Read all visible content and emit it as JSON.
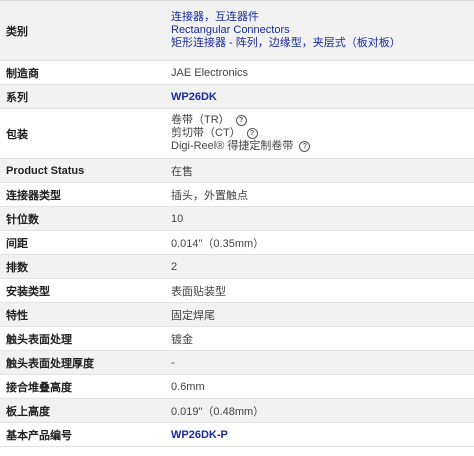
{
  "rows": [
    {
      "label": "类别",
      "values": [
        "连接器，互连器件",
        "Rectangular Connectors",
        "矩形连接器 - 阵列，边缘型，夹层式（板对板）"
      ]
    },
    {
      "label": "制造商",
      "value": "JAE Electronics"
    },
    {
      "label": "系列",
      "value": "WP26DK"
    },
    {
      "label": "包装",
      "packaging": [
        "卷带（TR）",
        "剪切带（CT）",
        "Digi-Reel® 得捷定制卷带"
      ]
    },
    {
      "label": "Product Status",
      "value": "在售"
    },
    {
      "label": "连接器类型",
      "value": "插头，外置触点"
    },
    {
      "label": "针位数",
      "value": "10"
    },
    {
      "label": "间距",
      "value": "0.014\"（0.35mm）"
    },
    {
      "label": "排数",
      "value": "2"
    },
    {
      "label": "安装类型",
      "value": "表面贴装型"
    },
    {
      "label": "特性",
      "value": "固定焊尾"
    },
    {
      "label": "触头表面处理",
      "value": "镀金"
    },
    {
      "label": "触头表面处理厚度",
      "value": "-"
    },
    {
      "label": "接合堆叠高度",
      "value": "0.6mm"
    },
    {
      "label": "板上高度",
      "value": "0.019\"（0.48mm）"
    },
    {
      "label": "基本产品编号",
      "value": "WP26DK-P"
    }
  ],
  "icons": {
    "help": "question-circle-icon"
  },
  "colors": {
    "link": "#1b2a9c",
    "row_alt": "#f2f2f2",
    "border": "#e2e2e2"
  }
}
